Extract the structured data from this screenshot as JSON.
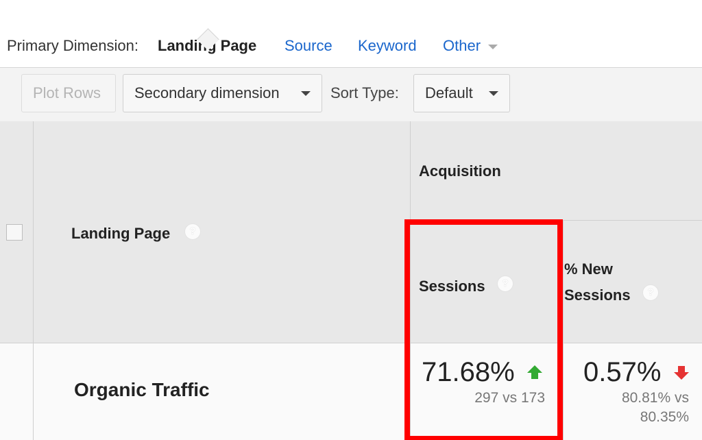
{
  "primary_dimension": {
    "label": "Primary Dimension:",
    "active": "Landing Page",
    "options": [
      "Source",
      "Keyword",
      "Other"
    ]
  },
  "toolbar": {
    "plot_rows_label": "Plot Rows",
    "secondary_dimension_label": "Secondary dimension",
    "sort_type_label": "Sort Type:",
    "sort_type_value": "Default"
  },
  "table": {
    "header": {
      "landing_page": "Landing Page",
      "group": "Acquisition",
      "sessions": "Sessions",
      "new_sessions_line1": "% New",
      "new_sessions_line2": "Sessions",
      "help_glyph": "?"
    },
    "rows": [
      {
        "label": "Organic Traffic",
        "sessions_change": "71.68%",
        "sessions_trend": "up",
        "sessions_compare": "297 vs 173",
        "new_sessions_change": "0.57%",
        "new_sessions_trend": "down",
        "new_sessions_compare_line1": "80.81% vs",
        "new_sessions_compare_line2": "80.35%"
      }
    ]
  },
  "colors": {
    "link": "#1a66cc",
    "trend_up": "#33aa33",
    "trend_down": "#e53333",
    "highlight": "#ff0000"
  }
}
